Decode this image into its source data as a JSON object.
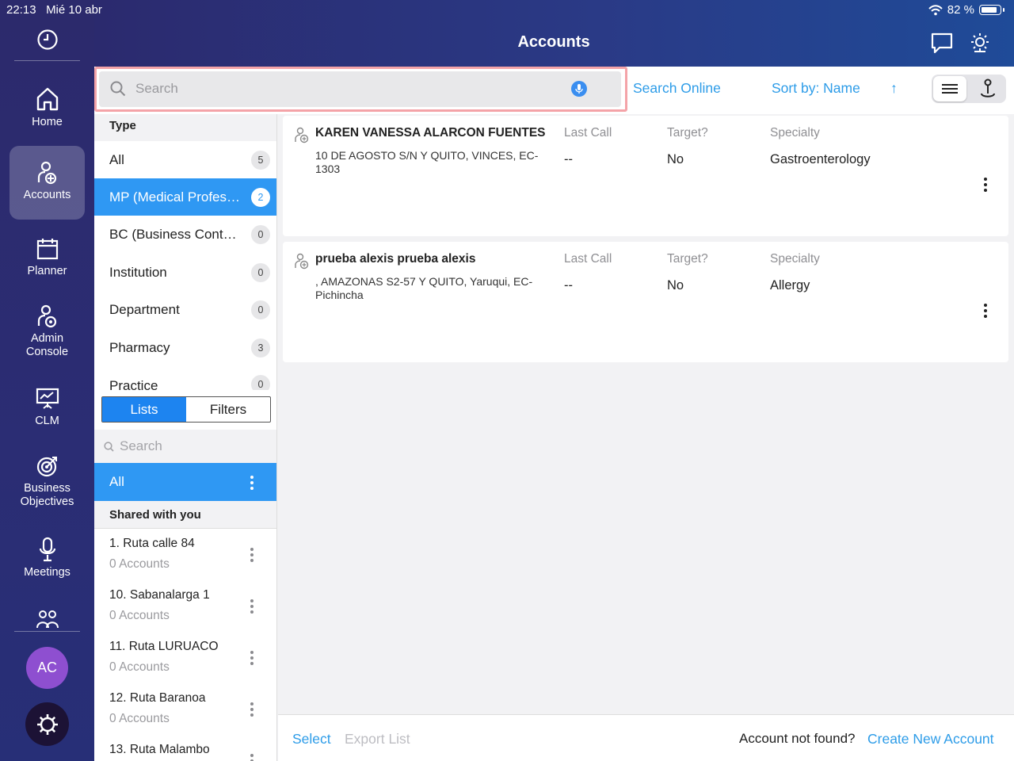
{
  "status": {
    "time": "22:13",
    "date": "Mié 10 abr",
    "battery": "82 %"
  },
  "header": {
    "title": "Accounts"
  },
  "nav": {
    "items": [
      {
        "label": "Home",
        "icon": "home-icon"
      },
      {
        "label": "Accounts",
        "icon": "accounts-icon",
        "active": true
      },
      {
        "label": "Planner",
        "icon": "calendar-icon"
      },
      {
        "label": "Admin Console",
        "icon": "admin-icon"
      },
      {
        "label": "CLM",
        "icon": "presentation-icon"
      },
      {
        "label": "Business Objectives",
        "icon": "target-icon"
      },
      {
        "label": "Meetings",
        "icon": "microphone-icon"
      }
    ],
    "avatar_initials": "AC"
  },
  "toolbar": {
    "search_placeholder": "Search",
    "search_online": "Search Online",
    "sort_by": "Sort by: Name",
    "sort_direction": "↑"
  },
  "types": {
    "header": "Type",
    "items": [
      {
        "label": "All",
        "count": "5"
      },
      {
        "label": "MP (Medical Professional)",
        "count": "2",
        "selected": true
      },
      {
        "label": "BC (Business Contact)",
        "count": "0"
      },
      {
        "label": "Institution",
        "count": "0"
      },
      {
        "label": "Department",
        "count": "0"
      },
      {
        "label": "Pharmacy",
        "count": "3"
      },
      {
        "label": "Practice",
        "count": "0"
      }
    ]
  },
  "segment": {
    "lists": "Lists",
    "filters": "Filters"
  },
  "lists": {
    "search_placeholder": "Search",
    "all_label": "All",
    "shared_header": "Shared with you",
    "items": [
      {
        "name": "1. Ruta calle 84",
        "count": "0 Accounts"
      },
      {
        "name": "10. Sabanalarga 1",
        "count": "0 Accounts"
      },
      {
        "name": "11. Ruta LURUACO",
        "count": "0 Accounts"
      },
      {
        "name": "12. Ruta Baranoa",
        "count": "0 Accounts"
      },
      {
        "name": "13. Ruta Malambo",
        "count": ""
      }
    ]
  },
  "columns": {
    "last_call": "Last Call",
    "target": "Target?",
    "specialty": "Specialty"
  },
  "accounts": [
    {
      "name": "KAREN VANESSA ALARCON FUENTES",
      "address": "10 DE AGOSTO S/N Y QUITO, VINCES, EC-1303",
      "last_call": "--",
      "target": "No",
      "specialty": "Gastroenterology"
    },
    {
      "name": "prueba alexis prueba alexis",
      "address": ", AMAZONAS S2-57 Y QUITO, Yaruqui, EC-Pichincha",
      "last_call": "--",
      "target": "No",
      "specialty": "Allergy"
    }
  ],
  "footer": {
    "select": "Select",
    "export": "Export List",
    "not_found": "Account not found?",
    "create": "Create New Account"
  },
  "colors": {
    "accent": "#2f98f3",
    "link": "#2d9ce8",
    "nav_bg": "#2b2d74",
    "avatar": "#8e4fd0"
  }
}
